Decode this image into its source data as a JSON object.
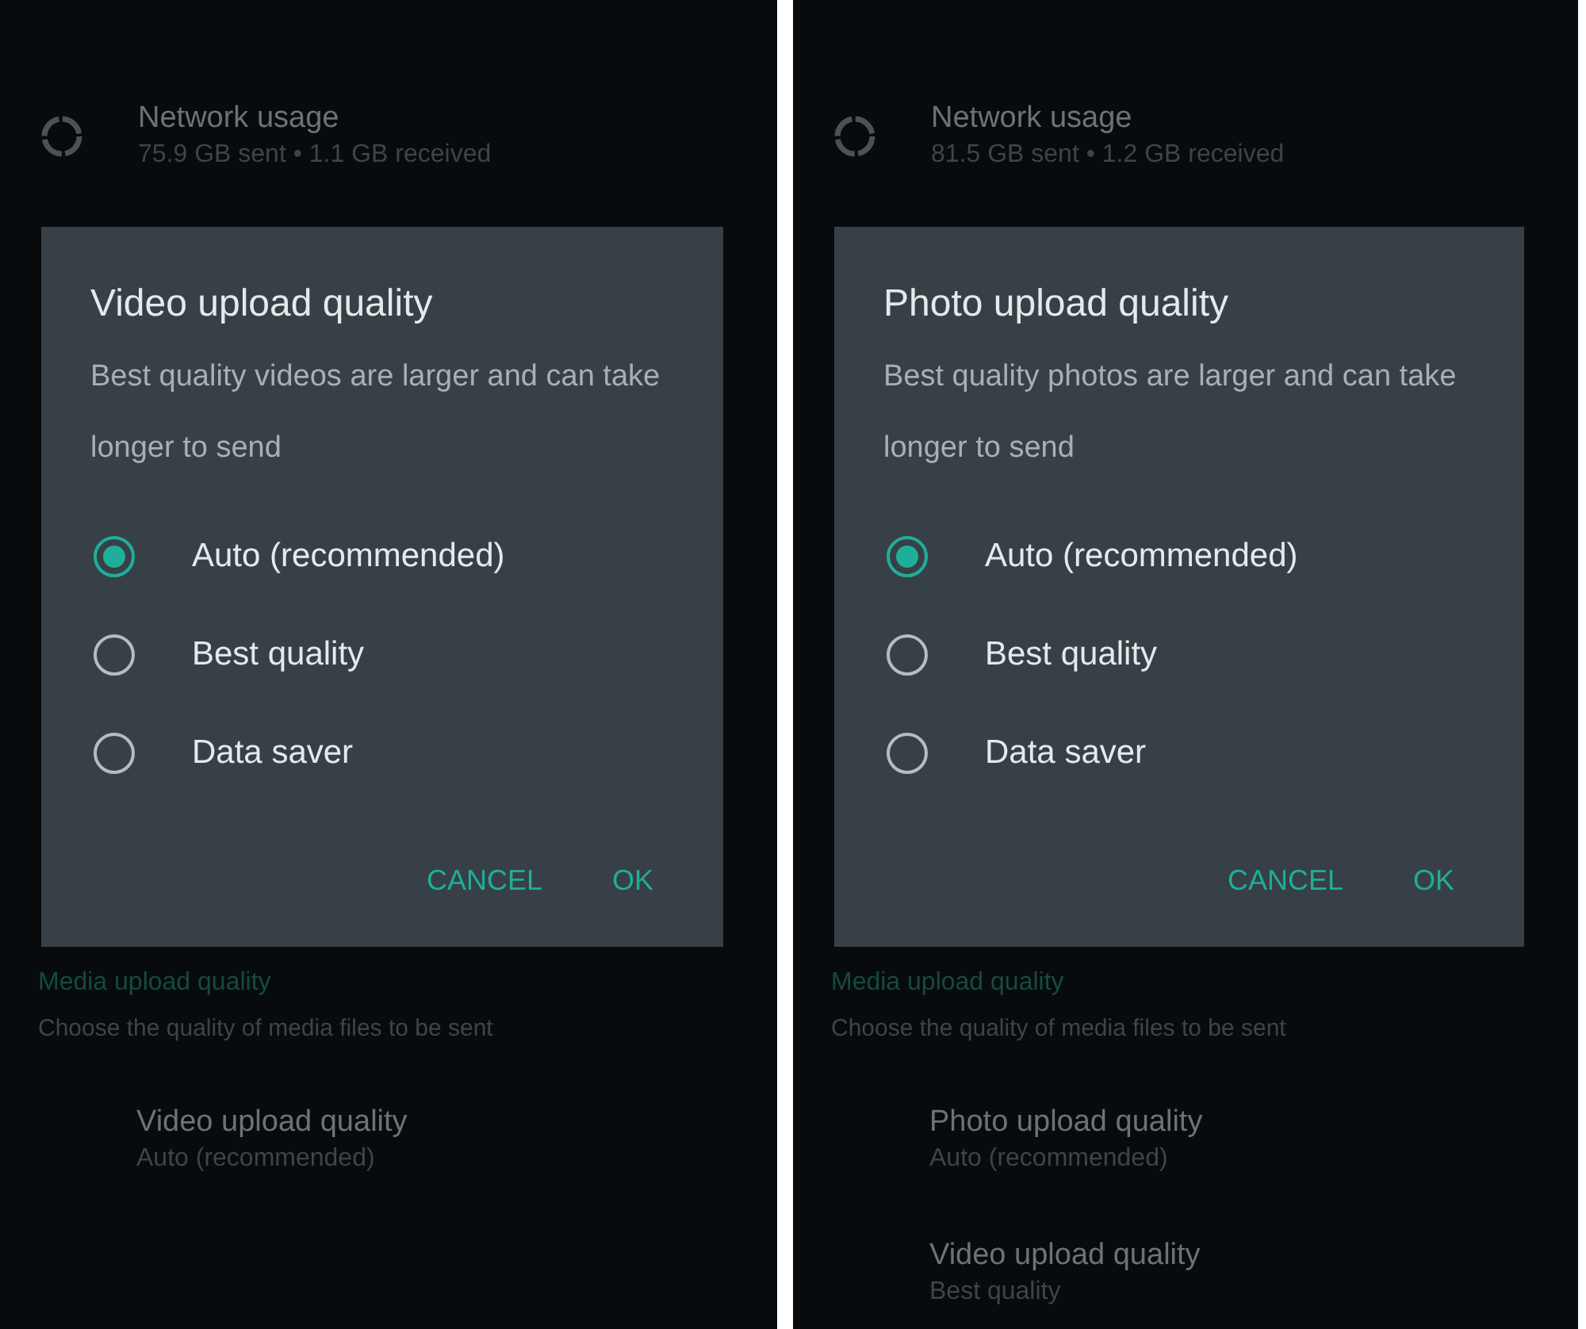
{
  "screens": [
    {
      "network_usage": {
        "title": "Network usage",
        "subtitle": "75.9 GB sent • 1.1 GB received"
      },
      "dialog": {
        "title": "Video upload quality",
        "message": "Best quality videos are larger and can take longer to send",
        "options": [
          {
            "label": "Auto (recommended)",
            "selected": true
          },
          {
            "label": "Best quality",
            "selected": false
          },
          {
            "label": "Data saver",
            "selected": false
          }
        ],
        "buttons": [
          "CANCEL",
          "OK"
        ]
      },
      "media_section": {
        "title": "Media upload quality",
        "subtitle": "Choose the quality of media files to be sent"
      },
      "items": [
        {
          "title": "Video upload quality",
          "subtitle": "Auto (recommended)"
        }
      ]
    },
    {
      "network_usage": {
        "title": "Network usage",
        "subtitle": "81.5 GB sent • 1.2 GB received"
      },
      "dialog": {
        "title": "Photo upload quality",
        "message": "Best quality photos are larger and can take longer to send",
        "options": [
          {
            "label": "Auto (recommended)",
            "selected": true
          },
          {
            "label": "Best quality",
            "selected": false
          },
          {
            "label": "Data saver",
            "selected": false
          }
        ],
        "buttons": [
          "CANCEL",
          "OK"
        ]
      },
      "media_section": {
        "title": "Media upload quality",
        "subtitle": "Choose the quality of media files to be sent"
      },
      "items": [
        {
          "title": "Photo upload quality",
          "subtitle": "Auto (recommended)"
        },
        {
          "title": "Video upload quality",
          "subtitle": "Best quality"
        }
      ]
    }
  ]
}
